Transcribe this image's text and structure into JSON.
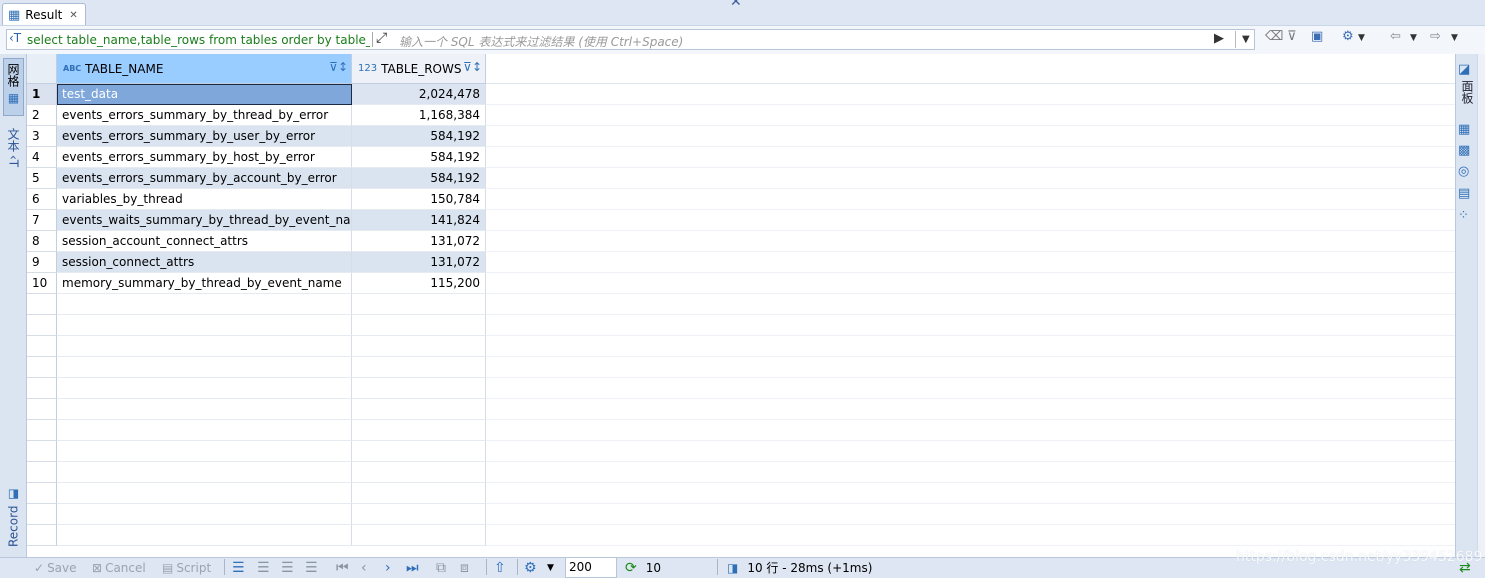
{
  "tab": {
    "title": "Result",
    "close": "✕"
  },
  "filter": {
    "query": "select table_name,table_rows from tables order by table_rc",
    "placeholder": "输入一个 SQL 表达式来过滤结果 (使用 Ctrl+Space)"
  },
  "left_tabs": {
    "grid": "网格",
    "text": "文本",
    "record": "Record"
  },
  "right_panel": {
    "label": "面板"
  },
  "columns": [
    {
      "type": "ABC",
      "name": "TABLE_NAME"
    },
    {
      "type": "123",
      "name": "TABLE_ROWS"
    }
  ],
  "rows": [
    {
      "n": "1",
      "name": "test_data",
      "rows": "2,024,478"
    },
    {
      "n": "2",
      "name": "events_errors_summary_by_thread_by_error",
      "rows": "1,168,384"
    },
    {
      "n": "3",
      "name": "events_errors_summary_by_user_by_error",
      "rows": "584,192"
    },
    {
      "n": "4",
      "name": "events_errors_summary_by_host_by_error",
      "rows": "584,192"
    },
    {
      "n": "5",
      "name": "events_errors_summary_by_account_by_error",
      "rows": "584,192"
    },
    {
      "n": "6",
      "name": "variables_by_thread",
      "rows": "150,784"
    },
    {
      "n": "7",
      "name": "events_waits_summary_by_thread_by_event_name",
      "rows": "141,824"
    },
    {
      "n": "8",
      "name": "session_account_connect_attrs",
      "rows": "131,072"
    },
    {
      "n": "9",
      "name": "session_connect_attrs",
      "rows": "131,072"
    },
    {
      "n": "10",
      "name": "memory_summary_by_thread_by_event_name",
      "rows": "115,200"
    }
  ],
  "status": {
    "save": "Save",
    "cancel": "Cancel",
    "script": "Script",
    "fetch_size": "200",
    "refresh_count": "10",
    "summary": "10 行 - 28ms (+1ms)"
  },
  "watermark": "https://blog.csdn.net/yy339452689"
}
